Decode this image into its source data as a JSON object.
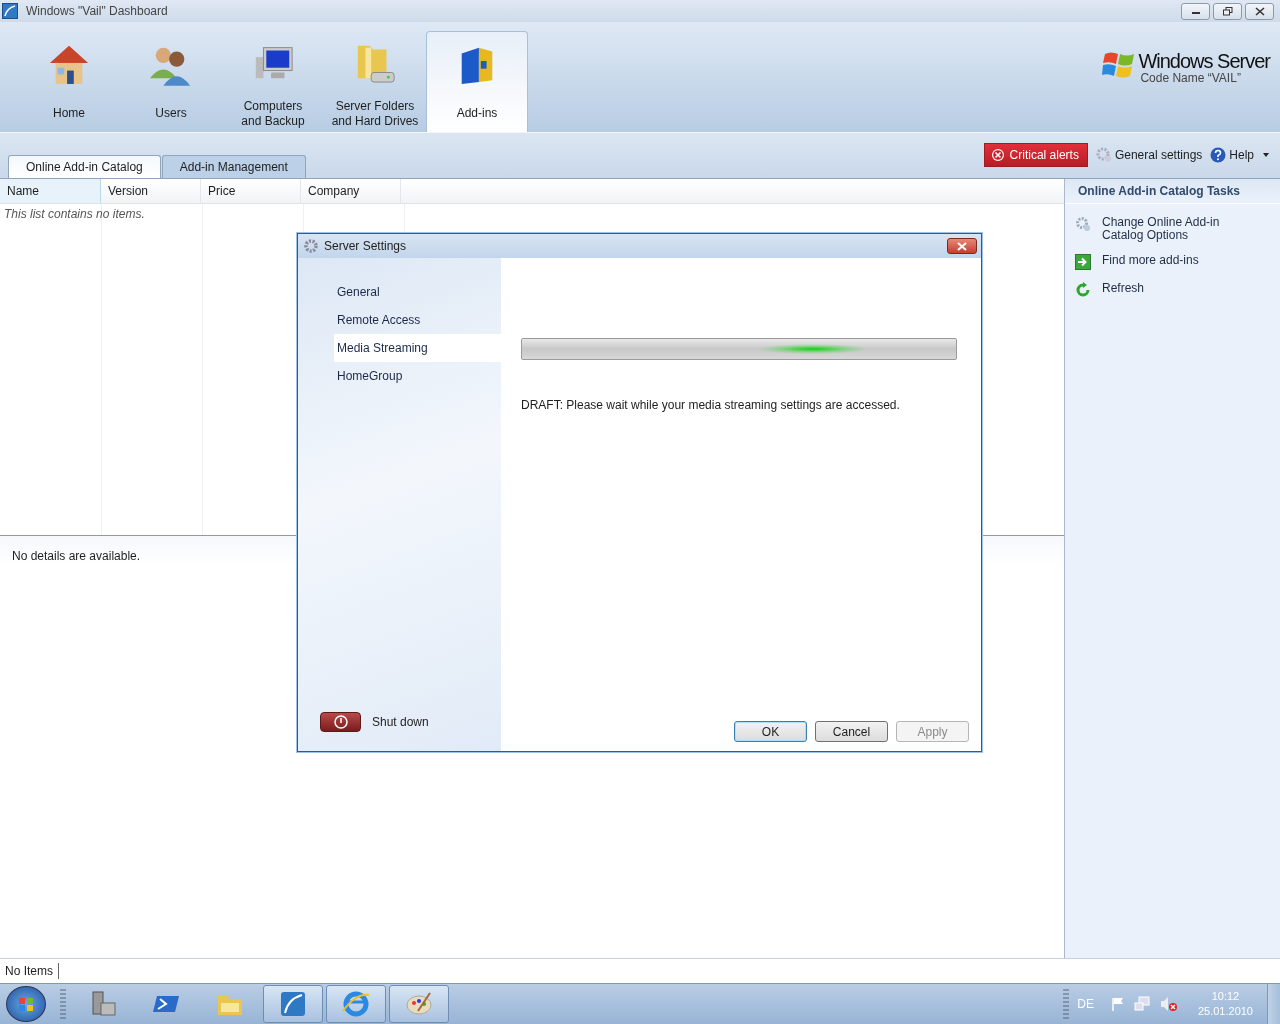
{
  "window": {
    "title": "Windows \"Vail\" Dashboard"
  },
  "nav": [
    {
      "lines": [
        "Home"
      ],
      "selected": false
    },
    {
      "lines": [
        "Users"
      ],
      "selected": false
    },
    {
      "lines": [
        "Computers",
        "and Backup"
      ],
      "selected": false
    },
    {
      "lines": [
        "Server Folders",
        "and Hard Drives"
      ],
      "selected": false
    },
    {
      "lines": [
        "Add-ins"
      ],
      "selected": true
    }
  ],
  "logo": {
    "title": "Windows Server",
    "subtitle": "Code Name “VAIL”"
  },
  "tabs": [
    {
      "label": "Online Add-in Catalog",
      "selected": true
    },
    {
      "label": "Add-in Management",
      "selected": false
    }
  ],
  "toolbar": {
    "alert": "Critical alerts",
    "settings": "General settings",
    "help": "Help"
  },
  "table": {
    "columns": [
      "Name",
      "Version",
      "Price",
      "Company"
    ],
    "empty_text": "This list contains no items."
  },
  "details": {
    "text": "No details are available."
  },
  "tasks": {
    "title": "Online Add-in Catalog Tasks",
    "items": [
      {
        "lines": [
          "Change Online Add-in",
          "Catalog Options"
        ]
      },
      {
        "lines": [
          "Find more add-ins"
        ]
      },
      {
        "lines": [
          "Refresh"
        ]
      }
    ]
  },
  "status_bar": {
    "text": "No Items"
  },
  "dialog": {
    "title": "Server Settings",
    "sections": [
      {
        "label": "General",
        "selected": false
      },
      {
        "label": "Remote Access",
        "selected": false
      },
      {
        "label": "Media Streaming",
        "selected": true
      },
      {
        "label": "HomeGroup",
        "selected": false
      }
    ],
    "progress": {
      "level": 0.67
    },
    "message": "DRAFT: Please wait while your media streaming settings are accessed.",
    "shutdown": "Shut down",
    "buttons": [
      {
        "label": "OK",
        "default": true,
        "disabled": false
      },
      {
        "label": "Cancel",
        "default": false,
        "disabled": false
      },
      {
        "label": "Apply",
        "default": false,
        "disabled": true
      }
    ]
  },
  "taskbar": {
    "items": [
      {
        "running": false
      },
      {
        "running": false
      },
      {
        "running": false
      },
      {
        "running": true
      },
      {
        "running": true
      },
      {
        "running": true
      }
    ],
    "language": "DE",
    "time": "10:12",
    "date": "25.01.2010"
  }
}
